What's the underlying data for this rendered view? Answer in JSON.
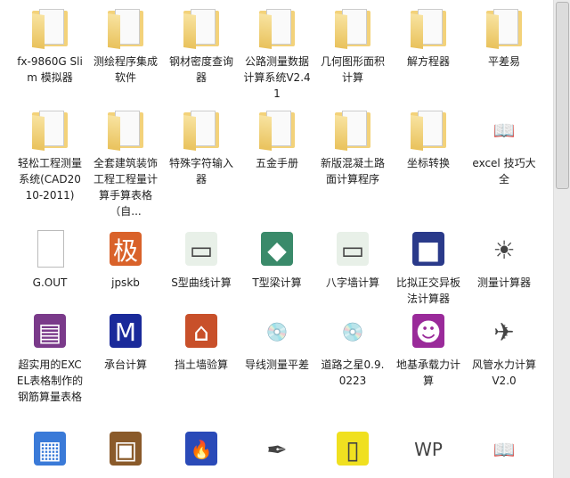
{
  "items": [
    {
      "label": "fx-9860G Slim 模拟器",
      "icon": "folder-icon",
      "kind": "folder"
    },
    {
      "label": "测绘程序集成软件",
      "icon": "folder-icon",
      "kind": "folder"
    },
    {
      "label": "钢材密度查询器",
      "icon": "folder-icon",
      "kind": "folder"
    },
    {
      "label": "公路测量数据计算系统V2.41",
      "icon": "folder-icon",
      "kind": "folder"
    },
    {
      "label": "几何图形面积计算",
      "icon": "folder-icon",
      "kind": "folder"
    },
    {
      "label": "解方程器",
      "icon": "folder-icon",
      "kind": "folder"
    },
    {
      "label": "平差易",
      "icon": "folder-icon",
      "kind": "folder"
    },
    {
      "label": "轻松工程测量系统(CAD2010-2011)",
      "icon": "folder-icon",
      "kind": "folder"
    },
    {
      "label": "全套建筑装饰工程工程量计算手算表格（自...",
      "icon": "folder-icon",
      "kind": "folder"
    },
    {
      "label": "特殊字符输入器",
      "icon": "folder-icon",
      "kind": "folder"
    },
    {
      "label": "五金手册",
      "icon": "folder-icon",
      "kind": "folder"
    },
    {
      "label": "新版混凝土路面计算程序",
      "icon": "folder-icon",
      "kind": "folder"
    },
    {
      "label": "坐标转换",
      "icon": "folder-icon",
      "kind": "folder"
    },
    {
      "label": "excel 技巧大全",
      "icon": "book-cd-icon",
      "kind": "app",
      "glyph": "📖",
      "bg": "#ffffff"
    },
    {
      "label": "G.OUT",
      "icon": "file-icon",
      "kind": "file"
    },
    {
      "label": "jpskb",
      "icon": "ji-app-icon",
      "kind": "app",
      "glyph": "极",
      "bg": "#d9622a"
    },
    {
      "label": "S型曲线计算",
      "icon": "window-app-icon",
      "kind": "app",
      "glyph": "▭",
      "bg": "#e8f0e8"
    },
    {
      "label": "T型梁计算",
      "icon": "lighthouse-icon",
      "kind": "app",
      "glyph": "◆",
      "bg": "#3a8a6a"
    },
    {
      "label": "八字墙计算",
      "icon": "window-app-icon",
      "kind": "app",
      "glyph": "▭",
      "bg": "#e8f0e8"
    },
    {
      "label": "比拟正交异板法计算器",
      "icon": "stamp-icon",
      "kind": "app",
      "glyph": "■",
      "bg": "#2a3a8a"
    },
    {
      "label": "测量计算器",
      "icon": "sun-icon",
      "kind": "app",
      "glyph": "☀",
      "bg": "#ffffff"
    },
    {
      "label": "超实用的EXCEL表格制作的钢筋算量表格",
      "icon": "winrar-icon",
      "kind": "app",
      "glyph": "▤",
      "bg": "#7a3a8a"
    },
    {
      "label": "承台计算",
      "icon": "mfc-icon",
      "kind": "app",
      "glyph": "M",
      "bg": "#1a2a9a"
    },
    {
      "label": "挡土墙验算",
      "icon": "house-icon",
      "kind": "app",
      "glyph": "⌂",
      "bg": "#c8502a"
    },
    {
      "label": "导线测量平差",
      "icon": "installer-icon",
      "kind": "app",
      "glyph": "💿",
      "bg": "#ffffff"
    },
    {
      "label": "道路之星0.9.0223",
      "icon": "installer-icon",
      "kind": "app",
      "glyph": "💿",
      "bg": "#ffffff"
    },
    {
      "label": "地基承载力计算",
      "icon": "mascot-icon",
      "kind": "app",
      "glyph": "☻",
      "bg": "#9a2a9a"
    },
    {
      "label": "风管水力计算V2.0",
      "icon": "airplane-icon",
      "kind": "app",
      "glyph": "✈",
      "bg": "#ffffff"
    },
    {
      "label": "",
      "icon": "spreadsheet-icon",
      "kind": "app",
      "glyph": "▦",
      "bg": "#3a7ad8"
    },
    {
      "label": "",
      "icon": "chip-icon",
      "kind": "app",
      "glyph": "▣",
      "bg": "#8a5a2a"
    },
    {
      "label": "",
      "icon": "torch-icon",
      "kind": "app",
      "glyph": "🔥",
      "bg": "#2a4ab8"
    },
    {
      "label": "",
      "icon": "ink-pen-icon",
      "kind": "app",
      "glyph": "✒",
      "bg": "#ffffff"
    },
    {
      "label": "",
      "icon": "yellow-app-icon",
      "kind": "app",
      "glyph": "▯",
      "bg": "#f0e020"
    },
    {
      "label": "",
      "icon": "wp-icon",
      "kind": "app",
      "glyph": "WP",
      "bg": "#ffffff"
    },
    {
      "label": "",
      "icon": "book-cd-icon",
      "kind": "app",
      "glyph": "📖",
      "bg": "#ffffff"
    }
  ]
}
